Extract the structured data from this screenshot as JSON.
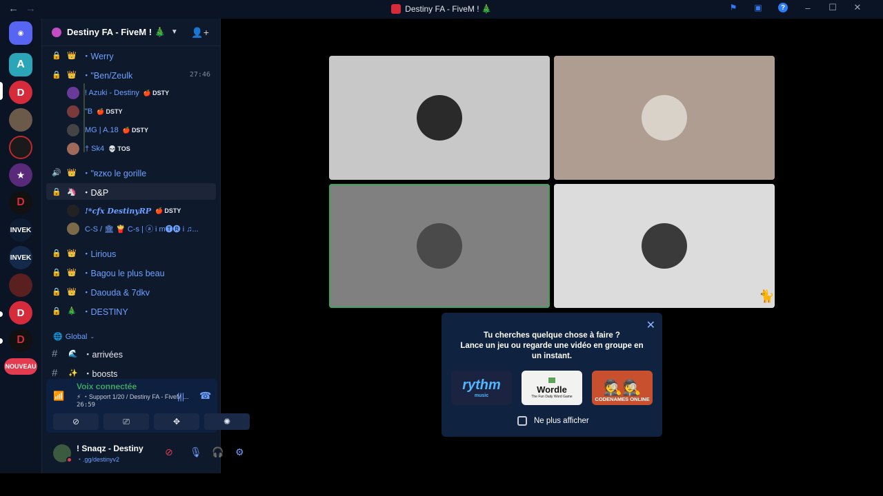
{
  "window": {
    "title": "Destiny FA - FiveM ! 🎄",
    "nav_back": "←",
    "nav_forward": "→",
    "icons": [
      "flag-icon",
      "screen-icon",
      "help-icon",
      "minimize-icon",
      "maximize-icon",
      "close-icon"
    ]
  },
  "rail": {
    "servers": [
      "discord-home",
      "arma",
      "destiny",
      "gta-avatar",
      "red-lips",
      "badge-server",
      "destiny-d",
      "invek",
      "invek-2",
      "fighters",
      "destiny-d-2",
      "destiny-d-3"
    ],
    "badge_text": "INVEK",
    "new_label": "NOUVEAU"
  },
  "server": {
    "name": "Destiny FA - FiveM ! 🎄",
    "channels": [
      {
        "emoji": "👑",
        "name": "・Werry"
      },
      {
        "emoji": "👑",
        "name": "・\"Ben/Zeulk",
        "time": "27:46"
      },
      {
        "emoji": "👑",
        "name": "・\"ʀᴢᴋᴏ le gorille"
      },
      {
        "emoji": "🦄",
        "name": "・D&P"
      },
      {
        "emoji": "👑",
        "name": "・Lirious"
      },
      {
        "emoji": "👑",
        "name": "・Bagou le plus beau"
      },
      {
        "emoji": "👑",
        "name": "・Daouda & 7dkv"
      },
      {
        "emoji": "🎄",
        "name": "・DESTINY"
      }
    ],
    "users_ben": [
      {
        "name": "! Azuki - Destiny",
        "tag": "DSTY"
      },
      {
        "name": "\"B",
        "tag": "DSTY"
      },
      {
        "name": "MG | A.18",
        "tag": "DSTY"
      },
      {
        "name": "† Sk4",
        "tag": "TOS"
      }
    ],
    "users_dp": [
      {
        "name": "!*cfx DestinyRP",
        "tag": "DSTY"
      },
      {
        "name": "C-S / 🏛 🍟 C-s | ⓐ i m🅣🅡 i ♫..."
      }
    ],
    "category": "Global",
    "text_channels": [
      {
        "emoji": "🌊",
        "name": "・arrivées"
      },
      {
        "emoji": "✨",
        "name": "・boosts"
      }
    ]
  },
  "voice": {
    "title": "Voix connectée",
    "sub": "⚡ ・Support 1/20 / Destiny FA - FiveM ...",
    "time": "26:59"
  },
  "user": {
    "name": "! Snaqz - Destiny",
    "status": "・.gg/destinyv2"
  },
  "stage": {
    "tiles": [
      {
        "bg": "#c8c8c8",
        "avatar": "#2a2a2a"
      },
      {
        "bg": "#b09d92",
        "avatar": "#d9d2c8"
      },
      {
        "bg": "#808080",
        "avatar": "#4a4a4a",
        "speaking": true
      },
      {
        "bg": "#dcdcdc",
        "avatar": "#3a3a3a"
      }
    ]
  },
  "popup": {
    "line1": "Tu cherches quelque chose à faire ?",
    "line2": "Lance un jeu ou regarde une vidéo en groupe en un instant.",
    "activities": [
      "rythm",
      "Wordle",
      "CODENAMES ONLINE"
    ],
    "rythm_sub": "music",
    "wordle_sub": "The Fun Daily Word Game",
    "dont_show": "Ne plus afficher"
  },
  "colors": {
    "accent": "#2f7df6",
    "link": "#6ea0ff",
    "green": "#3ba55d",
    "bg": "#0e1a2c"
  }
}
